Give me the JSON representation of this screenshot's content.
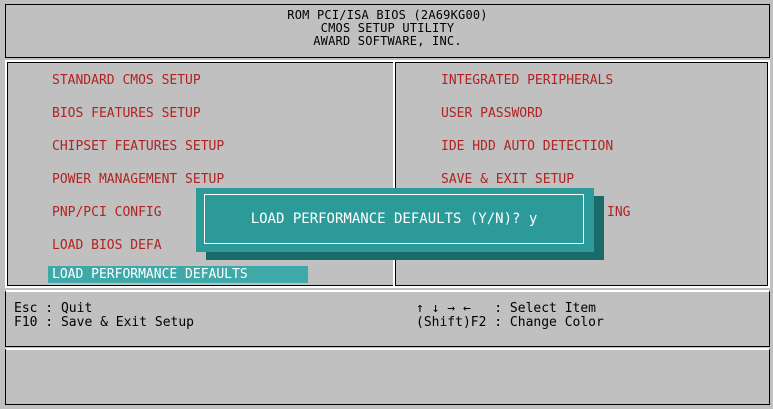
{
  "header": {
    "line1": "ROM PCI/ISA BIOS (2A69KG00)",
    "line2": "CMOS SETUP UTILITY",
    "line3": "AWARD SOFTWARE, INC."
  },
  "menu": {
    "left": [
      "STANDARD CMOS SETUP",
      "BIOS FEATURES SETUP",
      "CHIPSET FEATURES SETUP",
      "POWER MANAGEMENT SETUP",
      "PNP/PCI CONFIG",
      "LOAD BIOS DEFA",
      "LOAD PERFORMANCE DEFAULTS"
    ],
    "right": [
      "INTEGRATED PERIPHERALS",
      "USER PASSWORD",
      "IDE HDD AUTO DETECTION",
      "SAVE & EXIT SETUP",
      "ING"
    ],
    "selected": "LOAD PERFORMANCE DEFAULTS"
  },
  "help": {
    "left_line1": "Esc : Quit",
    "left_line2": "F10 : Save & Exit Setup",
    "right_line1": "↑ ↓ → ←   : Select Item",
    "right_line2": "(Shift)F2 : Change Color"
  },
  "dialog": {
    "prompt": "LOAD PERFORMANCE DEFAULTS (Y/N)? y"
  },
  "colors": {
    "background": "#c0c0c0",
    "menu_text": "#b22222",
    "highlight": "#3fa9a9",
    "dialog_bg": "#2d9a9a"
  }
}
